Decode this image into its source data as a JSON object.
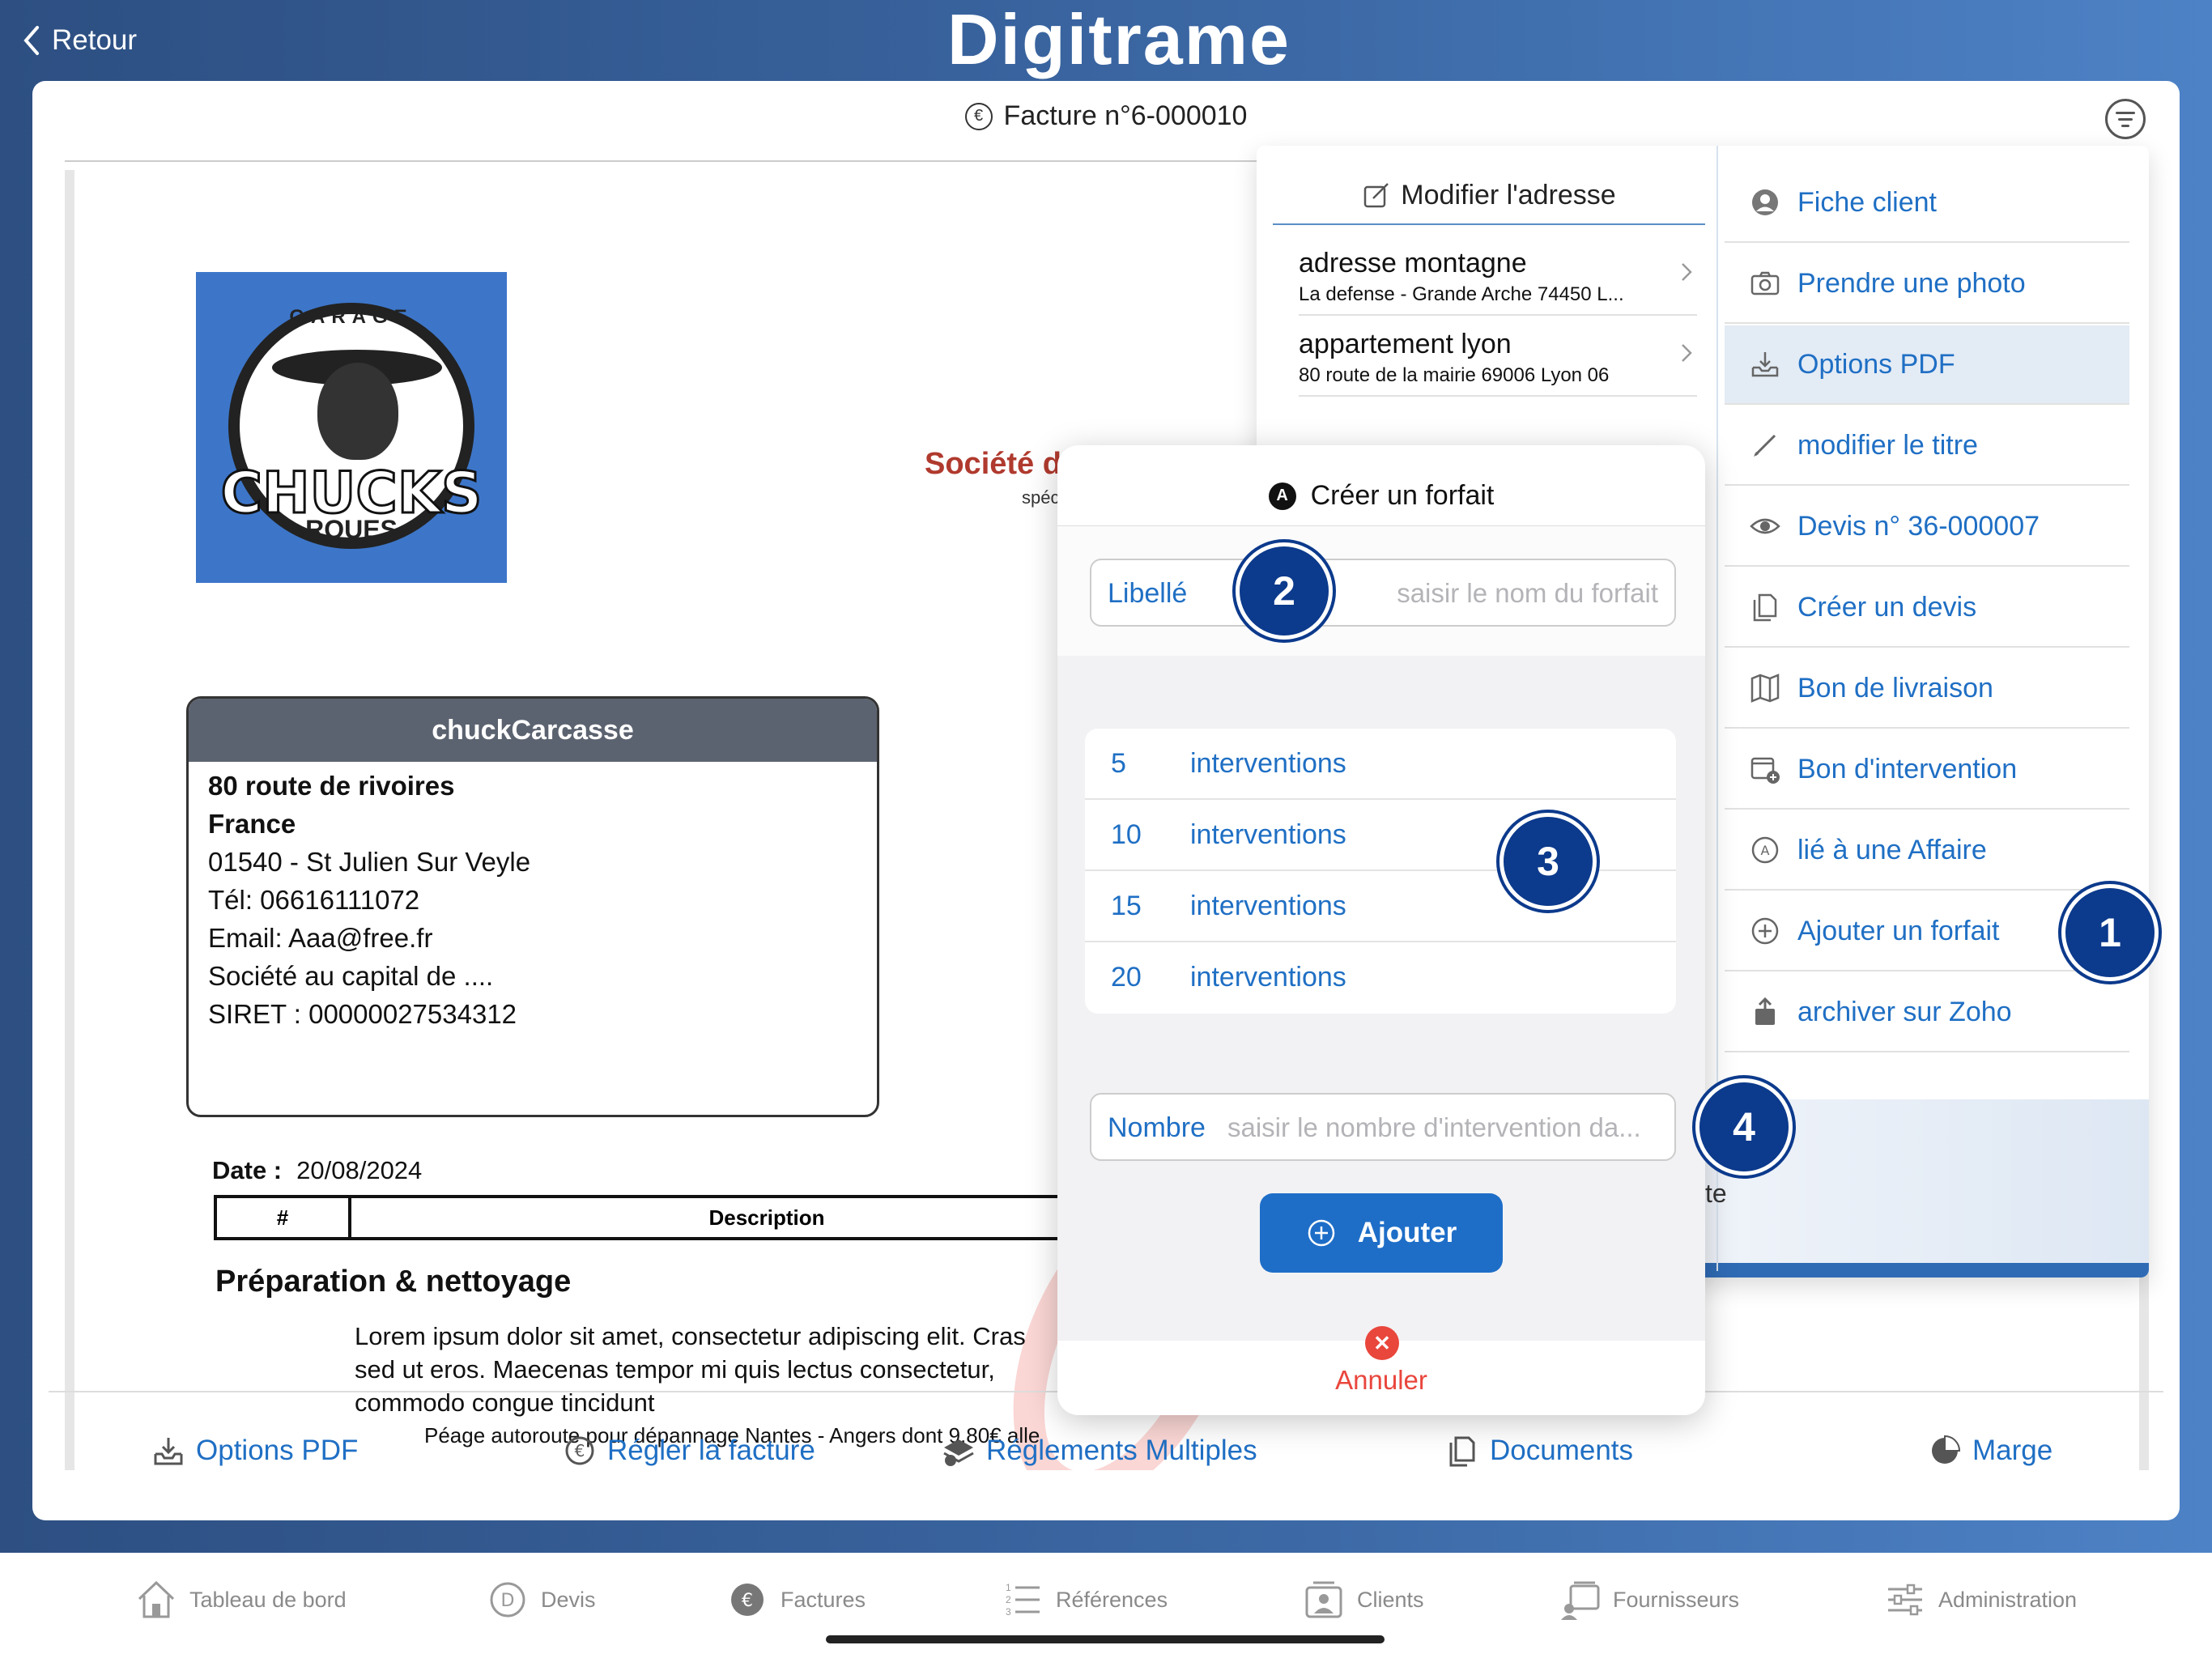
{
  "header": {
    "back_label": "Retour",
    "brand": "Digitrame"
  },
  "document": {
    "title": "Facture n°6-000010"
  },
  "invoice": {
    "logo_top_text": "GARAGE",
    "logo_text": "CHUCKS",
    "logo_sub": "ROUES",
    "company_name": "Société de dévemoppen",
    "company_tagline": "spécialisé swit et swift UI",
    "client": {
      "name": "chuckCarcasse",
      "line1": "80 route de rivoires",
      "line2": "France",
      "line3": "01540 - St Julien Sur Veyle",
      "line4": "Tél: 06616111072",
      "line5": "Email: Aaa@free.fr",
      "line6": "Société au capital de ....",
      "line7": "SIRET : 00000027534312"
    },
    "date_label": "Date :",
    "date_value": "20/08/2024",
    "table_col1": "#",
    "table_col2": "Description",
    "section_title": "Préparation & nettoyage",
    "lorem_1": "Lorem ipsum dolor sit amet, consectetur adipiscing elit. Cras",
    "lorem_2": "sed ut eros. Maecenas tempor mi quis lectus consectetur,",
    "lorem_3": "commodo congue tincidunt",
    "lorem_small": "Péage autoroute pour dépannage Nantes - Angers dont 9,80€ alle"
  },
  "popover": {
    "modify_address": "Modifier l'adresse",
    "addresses": [
      {
        "title": "adresse montagne",
        "subtitle": "La defense - Grande Arche 74450 L..."
      },
      {
        "title": "appartement lyon",
        "subtitle": "80 route de la mairie 69006 Lyon 06"
      }
    ],
    "menu": [
      {
        "label": "Fiche client",
        "icon": "person-icon"
      },
      {
        "label": "Prendre une photo",
        "icon": "camera-icon"
      },
      {
        "label": "Options PDF",
        "icon": "tray-download-icon"
      },
      {
        "label": "modifier le titre",
        "icon": "pencil-icon"
      },
      {
        "label": "Devis n° 36-000007",
        "icon": "eye-icon"
      },
      {
        "label": "Créer un devis",
        "icon": "documents-icon"
      },
      {
        "label": "Bon de livraison",
        "icon": "map-icon"
      },
      {
        "label": "Bon d'intervention",
        "icon": "calendar-add-icon"
      },
      {
        "label": "lié à une Affaire",
        "icon": "circle-a-icon"
      },
      {
        "label": "Ajouter un forfait",
        "icon": "plus-circle-icon"
      },
      {
        "label": "archiver sur Zoho",
        "icon": "share-icon"
      }
    ],
    "partial_text": "te"
  },
  "dialog": {
    "title": "Créer un forfait",
    "libelle_label": "Libellé",
    "libelle_placeholder": "saisir le nom du forfait",
    "presets": [
      {
        "number": "5",
        "label": "interventions"
      },
      {
        "number": "10",
        "label": "interventions"
      },
      {
        "number": "15",
        "label": "interventions"
      },
      {
        "number": "20",
        "label": "interventions"
      }
    ],
    "nombre_label": "Nombre",
    "nombre_placeholder": "saisir le nombre d'intervention da...",
    "add_label": "Ajouter",
    "cancel_label": "Annuler"
  },
  "steps": [
    "1",
    "2",
    "3",
    "4"
  ],
  "actions": [
    {
      "label": "Options PDF",
      "icon": "tray-download-icon"
    },
    {
      "label": "Régler la facture",
      "icon": "euro-circle-icon"
    },
    {
      "label": "Réglements Multiples",
      "icon": "stack-icon"
    },
    {
      "label": "Documents",
      "icon": "documents-icon"
    },
    {
      "label": "Marge",
      "icon": "pie-chart-icon"
    }
  ],
  "tabs": [
    {
      "label": "Tableau de bord",
      "icon": "house-icon"
    },
    {
      "label": "Devis",
      "icon": "d-circle-icon"
    },
    {
      "label": "Factures",
      "icon": "euro-circle-filled-icon"
    },
    {
      "label": "Références",
      "icon": "numbered-list-icon"
    },
    {
      "label": "Clients",
      "icon": "contact-card-icon"
    },
    {
      "label": "Fournisseurs",
      "icon": "supplier-icon"
    },
    {
      "label": "Administration",
      "icon": "sliders-icon"
    }
  ],
  "colors": {
    "accent": "#1f6fc4",
    "badge": "#0c3a8c",
    "cancel": "#e9463c",
    "company": "#b03a2e"
  }
}
